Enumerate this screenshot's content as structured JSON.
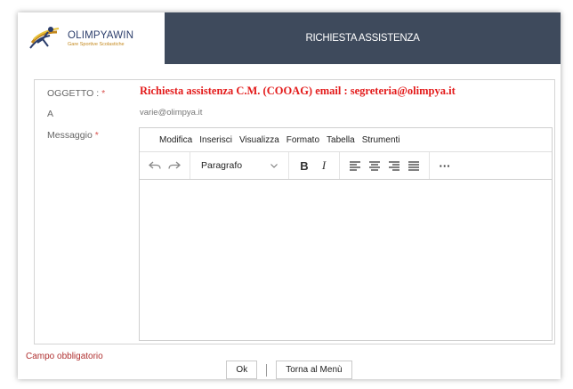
{
  "header": {
    "logo_title": "OLIMPYAWIN",
    "logo_subtitle": "Gare Sportive Scolastiche",
    "page_title": "RICHIESTA ASSISTENZA",
    "logo_colors": {
      "navy": "#2b3d6b",
      "gold": "#c4891d",
      "red": "#e31b1b"
    }
  },
  "form": {
    "subject_label": "OGGETTO : ",
    "subject_required": "*",
    "subject_value": "Richiesta assistenza C.M. (COOAG) email : segreteria@olimpya.it",
    "to_label": "A",
    "to_value": "varie@olimpya.it",
    "message_label": "Messaggio ",
    "message_required": "*"
  },
  "editor": {
    "menu": [
      "Modifica",
      "Inserisci",
      "Visualizza",
      "Formato",
      "Tabella",
      "Strumenti"
    ],
    "toolbar": {
      "undo_icon": "undo-icon",
      "redo_icon": "redo-icon",
      "block_format": "Paragrafo",
      "bold": "B",
      "italic": "I",
      "more": "···"
    },
    "content": ""
  },
  "validation": {
    "required_message": "Campo obbligatorio"
  },
  "footer": {
    "ok_label": "Ok",
    "back_label": "Torna al Menù"
  },
  "colors": {
    "header_bar": "#3e4a5c",
    "subject_text": "#e31b1b",
    "required_text": "#b03030"
  }
}
